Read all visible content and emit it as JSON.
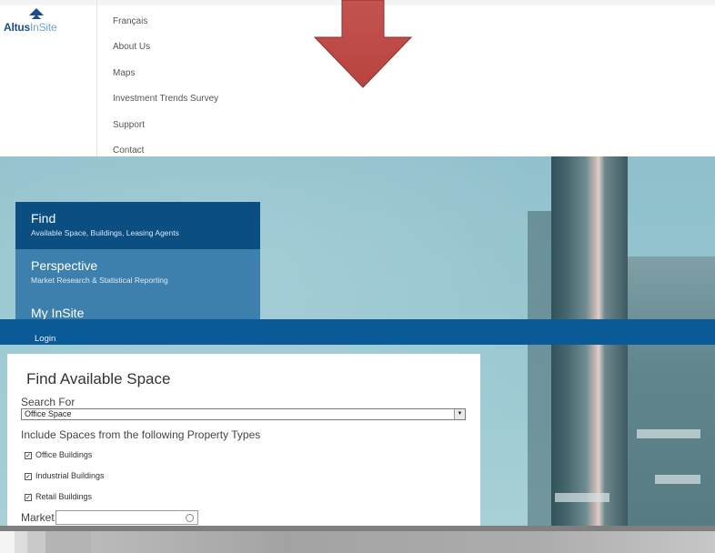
{
  "header": {
    "logo": {
      "part1": "Altus",
      "part2": "InSite"
    },
    "nav": [
      "Français",
      "About Us",
      "Maps",
      "Investment Trends Survey",
      "Support",
      "Contact"
    ]
  },
  "hero": {
    "menu": [
      {
        "title": "Find",
        "subtitle": "Available Space, Buildings, Leasing Agents"
      },
      {
        "title": "Perspective",
        "subtitle": "Market Research & Statistical Reporting"
      },
      {
        "title": "My InSite"
      }
    ],
    "login_label": "Login"
  },
  "search": {
    "title": "Find Available Space",
    "search_for_label": "Search For",
    "search_for_value": "Office Space",
    "include_label": "Include Spaces from the following Property Types",
    "property_types": [
      {
        "label": "Office Buildings",
        "checked": true
      },
      {
        "label": "Industrial Buildings",
        "checked": true
      },
      {
        "label": "Retail Buildings",
        "checked": true
      }
    ],
    "market_label": "Market",
    "market_value": ""
  },
  "colors": {
    "nav_dark": "#0b4e82",
    "nav_mid": "#3d80ad",
    "login_bar": "#0b5a98",
    "arrow": "#c0504d"
  },
  "icons": {
    "logo": "altus-logo-icon",
    "arrow": "down-arrow-icon",
    "dropdown": "dropdown-arrow-icon",
    "market": "circle-icon"
  }
}
